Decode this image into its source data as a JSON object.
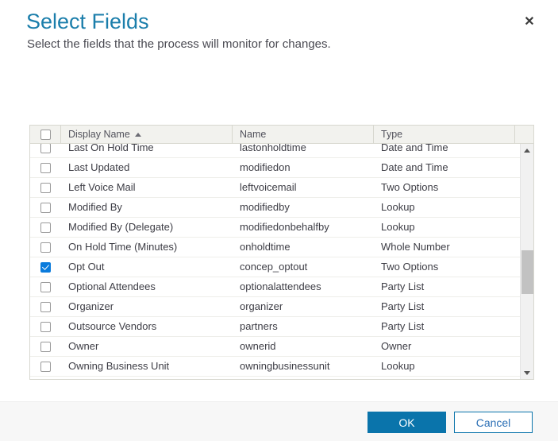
{
  "dialog": {
    "title": "Select Fields",
    "subtitle": "Select the fields that the process will monitor for changes.",
    "close_icon": "close-icon",
    "accent_color": "#1b7eab",
    "primary_button_color": "#0a74ab",
    "checkbox_checked_color": "#0a7bdc"
  },
  "grid": {
    "select_all_checked": false,
    "sort_column": "Display Name",
    "sort_direction": "ascending",
    "columns": [
      {
        "key": "checkbox",
        "label": ""
      },
      {
        "key": "display_name",
        "label": "Display Name"
      },
      {
        "key": "name",
        "label": "Name"
      },
      {
        "key": "type",
        "label": "Type"
      },
      {
        "key": "blank",
        "label": ""
      }
    ],
    "rows": [
      {
        "checked": false,
        "display_name": "Last On Hold Time",
        "name": "lastonholdtime",
        "type": "Date and Time"
      },
      {
        "checked": false,
        "display_name": "Last Updated",
        "name": "modifiedon",
        "type": "Date and Time"
      },
      {
        "checked": false,
        "display_name": "Left Voice Mail",
        "name": "leftvoicemail",
        "type": "Two Options"
      },
      {
        "checked": false,
        "display_name": "Modified By",
        "name": "modifiedby",
        "type": "Lookup"
      },
      {
        "checked": false,
        "display_name": "Modified By (Delegate)",
        "name": "modifiedonbehalfby",
        "type": "Lookup"
      },
      {
        "checked": false,
        "display_name": "On Hold Time (Minutes)",
        "name": "onholdtime",
        "type": "Whole Number"
      },
      {
        "checked": true,
        "display_name": "Opt Out",
        "name": "concep_optout",
        "type": "Two Options"
      },
      {
        "checked": false,
        "display_name": "Optional Attendees",
        "name": "optionalattendees",
        "type": "Party List"
      },
      {
        "checked": false,
        "display_name": "Organizer",
        "name": "organizer",
        "type": "Party List"
      },
      {
        "checked": false,
        "display_name": "Outsource Vendors",
        "name": "partners",
        "type": "Party List"
      },
      {
        "checked": false,
        "display_name": "Owner",
        "name": "ownerid",
        "type": "Owner"
      },
      {
        "checked": false,
        "display_name": "Owning Business Unit",
        "name": "owningbusinessunit",
        "type": "Lookup"
      }
    ],
    "scrollbar": {
      "up_arrow_icon": "chevron-up-icon",
      "down_arrow_icon": "chevron-down-icon"
    }
  },
  "footer": {
    "ok_label": "OK",
    "cancel_label": "Cancel"
  }
}
